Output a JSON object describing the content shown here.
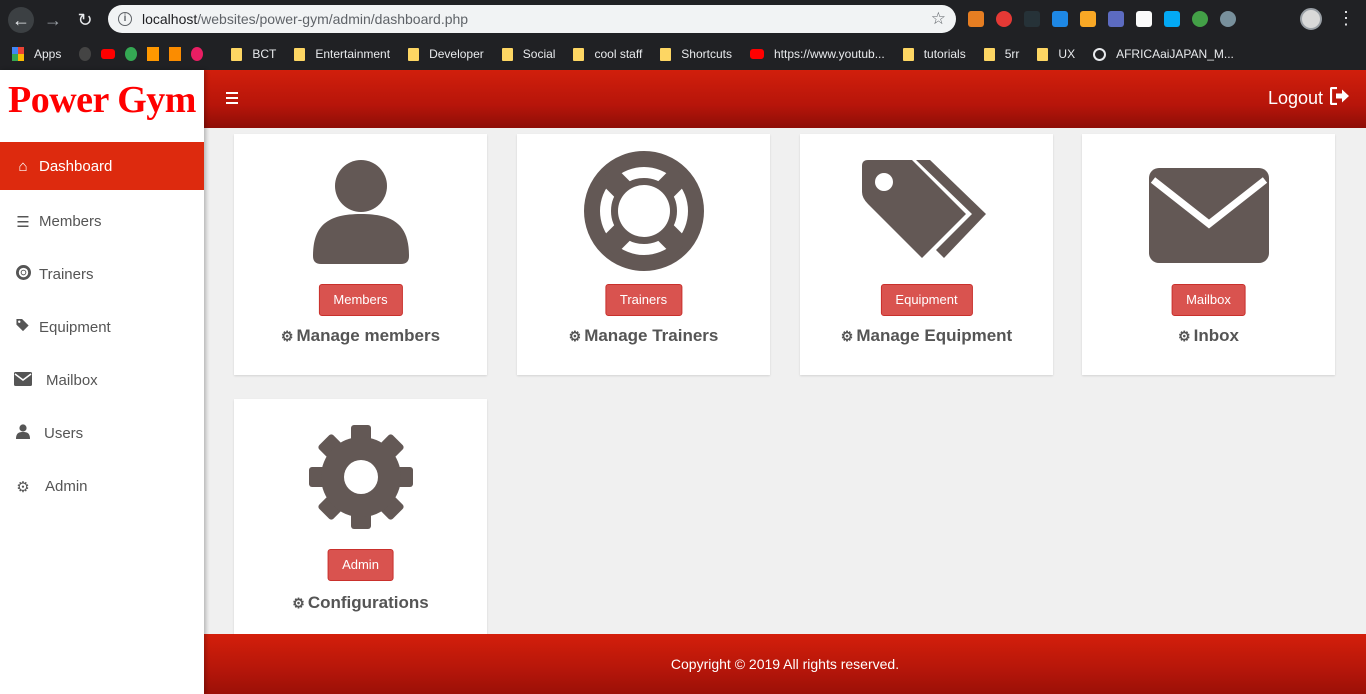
{
  "browser": {
    "url_host": "localhost",
    "url_path": "/websites/power-gym/admin/dashboard.php",
    "bookmarks": [
      "Apps",
      "BCT",
      "Entertainment",
      "Developer",
      "Social",
      "cool staff",
      "Shortcuts",
      "https://www.youtub...",
      "tutorials",
      "5rr",
      "UX",
      "AFRICAaiJAPAN_M..."
    ]
  },
  "sidebar": {
    "brand": "Power Gym",
    "items": [
      {
        "label": "Dashboard",
        "icon": "home-icon",
        "active": true
      },
      {
        "label": "Members",
        "icon": "list-icon"
      },
      {
        "label": "Trainers",
        "icon": "life-ring-icon"
      },
      {
        "label": "Equipment",
        "icon": "tags-icon"
      },
      {
        "label": "Mailbox",
        "icon": "envelope-icon"
      },
      {
        "label": "Users",
        "icon": "user-icon"
      },
      {
        "label": "Admin",
        "icon": "cog-icon"
      }
    ]
  },
  "header": {
    "logout_label": "Logout"
  },
  "cards": [
    {
      "button": "Members",
      "caption": "Manage members",
      "icon": "user-icon"
    },
    {
      "button": "Trainers",
      "caption": "Manage Trainers",
      "icon": "life-ring-icon"
    },
    {
      "button": "Equipment",
      "caption": "Manage Equipment",
      "icon": "tags-icon"
    },
    {
      "button": "Mailbox",
      "caption": "Inbox",
      "icon": "envelope-icon"
    },
    {
      "button": "Admin",
      "caption": "Configurations",
      "icon": "cog-icon"
    }
  ],
  "footer": {
    "copyright": "Copyright © 2019 All rights reserved."
  },
  "colors": {
    "brand": "#ff0000",
    "accent": "#dd2a0e",
    "button": "#d9534f",
    "icon": "#635855"
  }
}
